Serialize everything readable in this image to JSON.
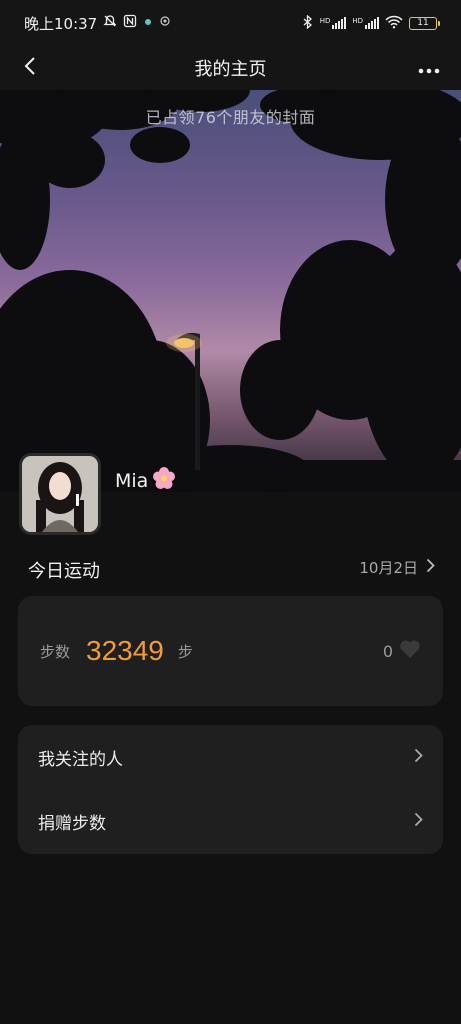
{
  "status_bar": {
    "time": "晚上10:37",
    "battery": "11",
    "net_label_1": "HD",
    "net_label_2": "HD"
  },
  "nav": {
    "title": "我的主页"
  },
  "cover": {
    "caption": "已占领76个朋友的封面"
  },
  "profile": {
    "username": "Mia"
  },
  "today": {
    "section_title": "今日运动",
    "date": "10月2日",
    "steps_label": "步数",
    "steps_value": "32349",
    "steps_unit": "步",
    "likes": "0"
  },
  "menu": {
    "items": [
      {
        "label": "我关注的人"
      },
      {
        "label": "捐赠步数"
      }
    ]
  },
  "colors": {
    "accent": "#f29b38",
    "background": "#111111",
    "card": "#1f1f1f"
  },
  "icons": [
    "back-arrow-icon",
    "more-dots-icon",
    "chevron-right-icon",
    "heart-icon",
    "flower-emoji-icon"
  ]
}
